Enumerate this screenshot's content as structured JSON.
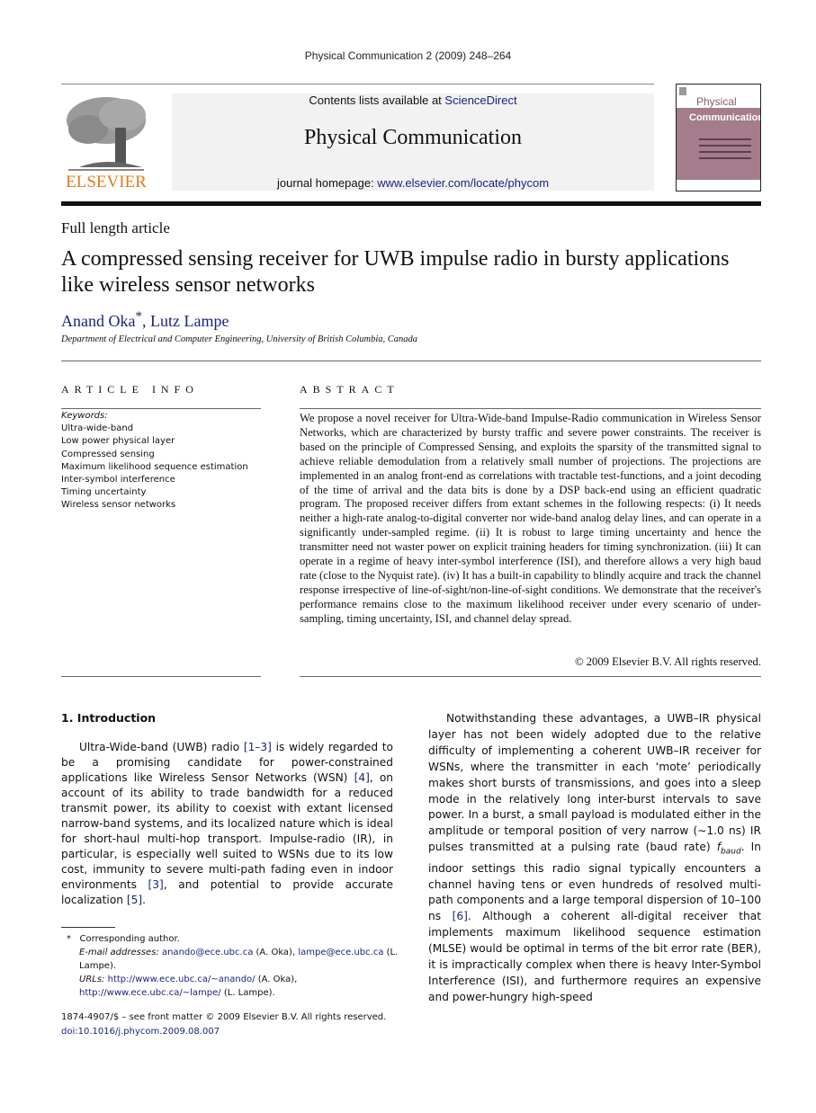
{
  "running_head": "Physical Communication 2 (2009) 248–264",
  "publisher": {
    "logo_text": "ELSEVIER"
  },
  "banner": {
    "contents_prefix": "Contents lists available at ",
    "contents_link": "ScienceDirect",
    "journal_title": "Physical Communication",
    "homepage_prefix": "journal homepage: ",
    "homepage_link": "www.elsevier.com/locate/phycom"
  },
  "cover": {
    "title_line1": "Physical",
    "title_line2": "Communication"
  },
  "article": {
    "type": "Full length article",
    "title": "A compressed sensing receiver for UWB impulse radio in bursty applications like wireless sensor networks",
    "authors": [
      {
        "name": "Anand Oka",
        "mark": "*"
      },
      {
        "name": "Lutz Lampe",
        "mark": ""
      }
    ],
    "author_sep": ", ",
    "affiliation": "Department of Electrical and Computer Engineering, University of British Columbia, Canada"
  },
  "article_info": {
    "heading": "ARTICLE INFO",
    "keywords_label": "Keywords:",
    "keywords": [
      "Ultra-wide-band",
      "Low power physical layer",
      "Compressed sensing",
      "Maximum likelihood sequence estimation",
      "Inter-symbol interference",
      "Timing uncertainty",
      "Wireless sensor networks"
    ]
  },
  "abstract": {
    "heading": "ABSTRACT",
    "text": "We propose a novel receiver for Ultra-Wide-band Impulse-Radio communication in Wireless Sensor Networks, which are characterized by bursty traffic and severe power constraints. The receiver is based on the principle of Compressed Sensing, and exploits the sparsity of the transmitted signal to achieve reliable demodulation from a relatively small number of projections. The projections are implemented in an analog front-end as correlations with tractable test-functions, and a joint decoding of the time of arrival and the data bits is done by a DSP back-end using an efficient quadratic program. The proposed receiver differs from extant schemes in the following respects: (i) It needs neither a high-rate analog-to-digital converter nor wide-band analog delay lines, and can operate in a significantly under-sampled regime. (ii) It is robust to large timing uncertainty and hence the transmitter need not waster power on explicit training headers for timing synchronization. (iii) It can operate in a regime of heavy inter-symbol interference (ISI), and therefore allows a very high baud rate (close to the Nyquist rate). (iv) It has a built-in capability to blindly acquire and track the channel response irrespective of line-of-sight/non-line-of-sight conditions. We demonstrate that the receiver's performance remains close to the maximum likelihood receiver under every scenario of under-sampling, timing uncertainty, ISI, and channel delay spread.",
    "copyright": "© 2009 Elsevier B.V. All rights reserved."
  },
  "intro": {
    "heading": "1.  Introduction",
    "p1": [
      {
        "t": "Ultra-Wide-band (UWB) radio "
      },
      {
        "t": "[1–3]",
        "link": true
      },
      {
        "t": " is widely regarded to be a promising candidate for power-constrained applications like Wireless Sensor Networks (WSN) "
      },
      {
        "t": "[4]",
        "link": true
      },
      {
        "t": ", on account of its ability to trade bandwidth for a reduced transmit power, its ability to coexist with extant licensed narrow-band systems, and its localized nature which is ideal for short-haul multi-hop transport. Impulse-radio (IR), in particular, is especially well suited to WSNs due to its low cost, immunity to severe multi-path fading even in indoor environments "
      },
      {
        "t": "[3]",
        "link": true
      },
      {
        "t": ", and potential to provide accurate localization "
      },
      {
        "t": "[5]",
        "link": true
      },
      {
        "t": "."
      }
    ],
    "p2": [
      {
        "t": "Notwithstanding these advantages, a UWB–IR physical layer has not been widely adopted due to the relative difficulty of implementing a coherent UWB–IR receiver for WSNs, where the transmitter in each ‘mote’ periodically makes short bursts of transmissions, and goes into a sleep mode in the relatively long inter-burst intervals to save power. In a burst, a small payload is modulated either in the amplitude or temporal position of very narrow (∼1.0 ns) IR pulses transmitted at a pulsing rate (baud rate) "
      },
      {
        "t": "f",
        "italic": true
      },
      {
        "t": "baud",
        "sub": true
      },
      {
        "t": ". In indoor settings this radio signal typically encounters a channel having tens or even hundreds of resolved multi-path components and a large temporal dispersion of 10–100 ns "
      },
      {
        "t": "[6]",
        "link": true
      },
      {
        "t": ". Although a coherent all-digital receiver that implements maximum likelihood sequence estimation (MLSE) would be optimal in terms of the bit error rate (BER), it is impractically complex when there is heavy Inter-Symbol Interference (ISI), and furthermore requires an expensive and power-hungry high-speed"
      }
    ]
  },
  "footnotes": {
    "mark": "*",
    "corresponding": "Corresponding author.",
    "email_label": "E-mail addresses:",
    "email1": "anando@ece.ubc.ca",
    "email1_who": " (A. Oka), ",
    "email2": "lampe@ece.ubc.ca",
    "email2_who": " (L. Lampe).",
    "urls_label": "URLs:",
    "url1": "http://www.ece.ubc.ca/~anando/",
    "url1_who": " (A. Oka),",
    "url2": "http://www.ece.ubc.ca/~lampe/",
    "url2_who": " (L. Lampe)."
  },
  "front_matter": {
    "issn_line": "1874-4907/$ – see front matter © 2009 Elsevier B.V. All rights reserved.",
    "doi": "doi:10.1016/j.phycom.2009.08.007"
  }
}
